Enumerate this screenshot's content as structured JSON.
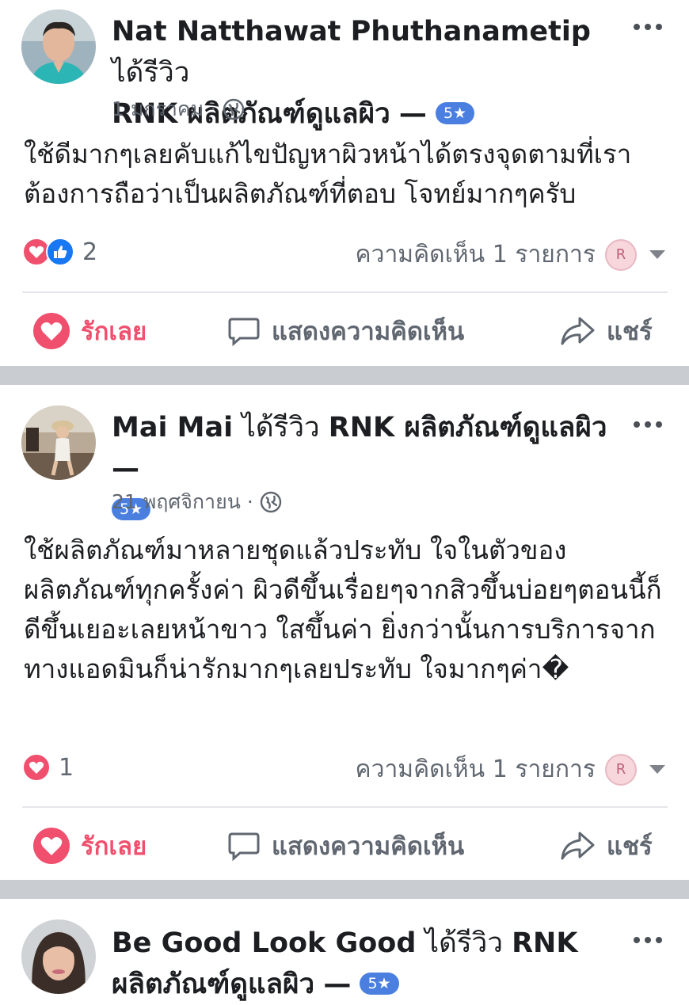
{
  "posts": [
    {
      "author": "Nat Natthawat Phuthanametip",
      "verb": "ได้รีวิว",
      "page": "RNK ผลิตภัณฑ์ดูแลผิว",
      "dash": "—",
      "rating": "5★",
      "date": "1 มกราคม",
      "dot": "·",
      "text": "ใช้ดีมากๆเลยคับแก้ไขปัญหาผิวหน้าได้ตรงจุดตามที่เราต้องการถือว่าเป็นผลิตภัณฑ์ที่ตอบ โจทย์มากๆครับ",
      "reaction_count": "2",
      "comments": "ความคิดเห็น 1 รายการ"
    },
    {
      "author": "Mai Mai",
      "verb": "ได้รีวิว",
      "page": "RNK ผลิตภัณฑ์ดูแลผิว",
      "dash": "—",
      "rating": "5★",
      "date": "21 พฤศจิกายน",
      "dot": "·",
      "text": "ใช้ผลิตภัณฑ์มาหลายชุดแล้วประทับ ใจในตัวของผลิตภัณฑ์ทุกครั้งค่า ผิวดีขึ้นเรื่อยๆจากสิวขึ้นบ่อยๆตอนนี้ก็ดีขึ้นเยอะเลยหน้าขาว ใสขึ้นค่า ยิ่งกว่านั้นการบริการจากทางแอดมินก็น่ารักมากๆเลยประทับ ใจมากๆค่า�",
      "reaction_count": "1",
      "comments": "ความคิดเห็น 1 รายการ"
    },
    {
      "author": "Be Good Look Good",
      "verb": "ได้รีวิว",
      "page": "RNK ผลิตภัณฑ์ดูแลผิว",
      "dash": "—",
      "rating": "5★"
    }
  ],
  "actions": {
    "like": "รักเลย",
    "comment": "แสดงความคิดเห็น",
    "share": "แชร์"
  },
  "colors": {
    "love": "#f0506e",
    "like_blue": "#1877f2",
    "rating_badge": "#4a7fe0",
    "separator": "#c9ccd1"
  }
}
